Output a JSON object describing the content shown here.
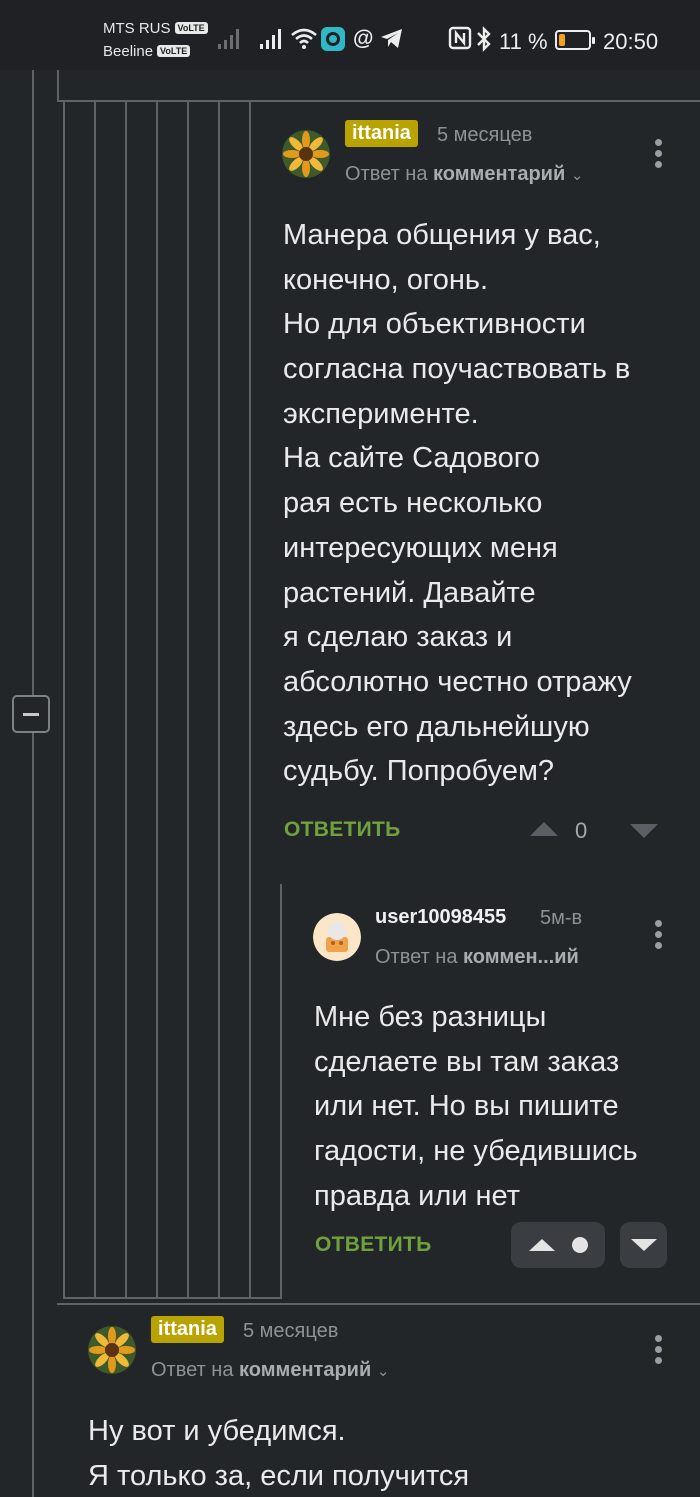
{
  "status_bar": {
    "carrier1": "MTS RUS",
    "carrier2": "Beeline",
    "volte": "VoLTE",
    "battery_percent": "11 %",
    "time": "20:50",
    "battery_level": 0.11,
    "battery_color": "#f5a020"
  },
  "comments": [
    {
      "username": "ittania",
      "time": "5 месяцев",
      "reply_prefix": "Ответ на",
      "reply_target": "комментарий",
      "body_lines": [
        "Манера общения у вас,",
        "конечно, огонь.",
        "Но для объективности",
        "согласна поучаствовать в",
        "эксперименте.",
        "На сайте Садового",
        "рая есть несколько",
        "интересующих меня",
        "растений. Давайте",
        "я сделаю заказ и",
        "абсолютно честно отражу",
        "здесь его дальнейшую",
        "судьбу. Попробуем?"
      ],
      "reply_label": "ОТВЕТИТЬ",
      "votes": "0"
    },
    {
      "username": "user10098455",
      "time": "5м-в",
      "reply_prefix": "Ответ на",
      "reply_target": "коммен...ий",
      "body_lines": [
        "Мне без разницы",
        "сделаете вы там заказ",
        "или нет. Но вы пишите",
        "гадости, не убедившись",
        "правда или нет"
      ],
      "reply_label": "ОТВЕТИТЬ"
    },
    {
      "username": "ittania",
      "time": "5 месяцев",
      "reply_prefix": "Ответ на",
      "reply_target": "комментарий",
      "body_lines": [
        "Ну вот и убедимся.",
        "Я только за, если получится"
      ]
    }
  ],
  "colors": {
    "background": "#232629",
    "thread_line": "#5f6368",
    "badge": "#b9a300",
    "reply_button": "#6fa23c",
    "muted_text": "#8e9297"
  }
}
